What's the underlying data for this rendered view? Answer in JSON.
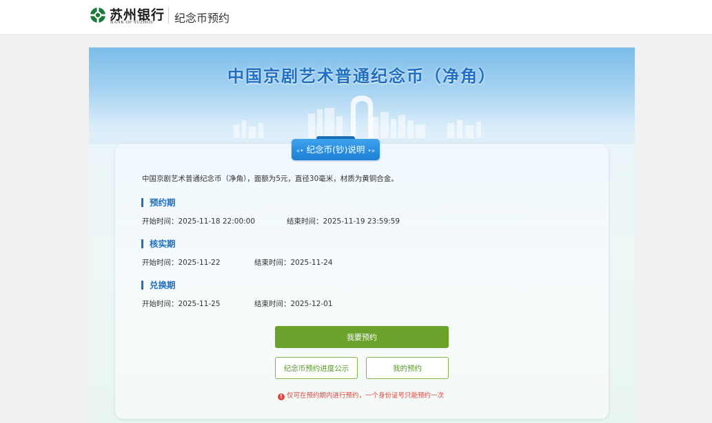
{
  "header": {
    "bank_name_cn": "苏州银行",
    "bank_name_en": "BANK OF SUZHOU",
    "page_title": "纪念币预约",
    "brand_color": "#1a7a3a"
  },
  "banner": {
    "title": "中国京剧艺术普通纪念币（净角）"
  },
  "section": {
    "badge_label": "纪念币(钞)说明",
    "intro": "中国京剧艺术普通纪念币（净角），面额为5元，直径30毫米，材质为黄铜合金。"
  },
  "periods": [
    {
      "title": "预约期",
      "start_label": "开始时间：",
      "start": "2025-11-18 22:00:00",
      "end_label": "结束时间：",
      "end": "2025-11-19 23:59:59"
    },
    {
      "title": "核实期",
      "start_label": "开始时间：",
      "start": "2025-11-22",
      "end_label": "结束时间：",
      "end": "2025-11-24"
    },
    {
      "title": "兑换期",
      "start_label": "开始时间：",
      "start": "2025-11-25",
      "end_label": "结束时间：",
      "end": "2025-12-01"
    }
  ],
  "actions": {
    "reserve": "我要预约",
    "progress": "纪念币预约进度公示",
    "my_reservation": "我的预约"
  },
  "notice": "仅可在预约期内进行预约，一个身份证号只能预约一次",
  "colors": {
    "accent_blue": "#1f6fc2",
    "primary_green": "#6aa22c",
    "warning_red": "#d9443c"
  }
}
